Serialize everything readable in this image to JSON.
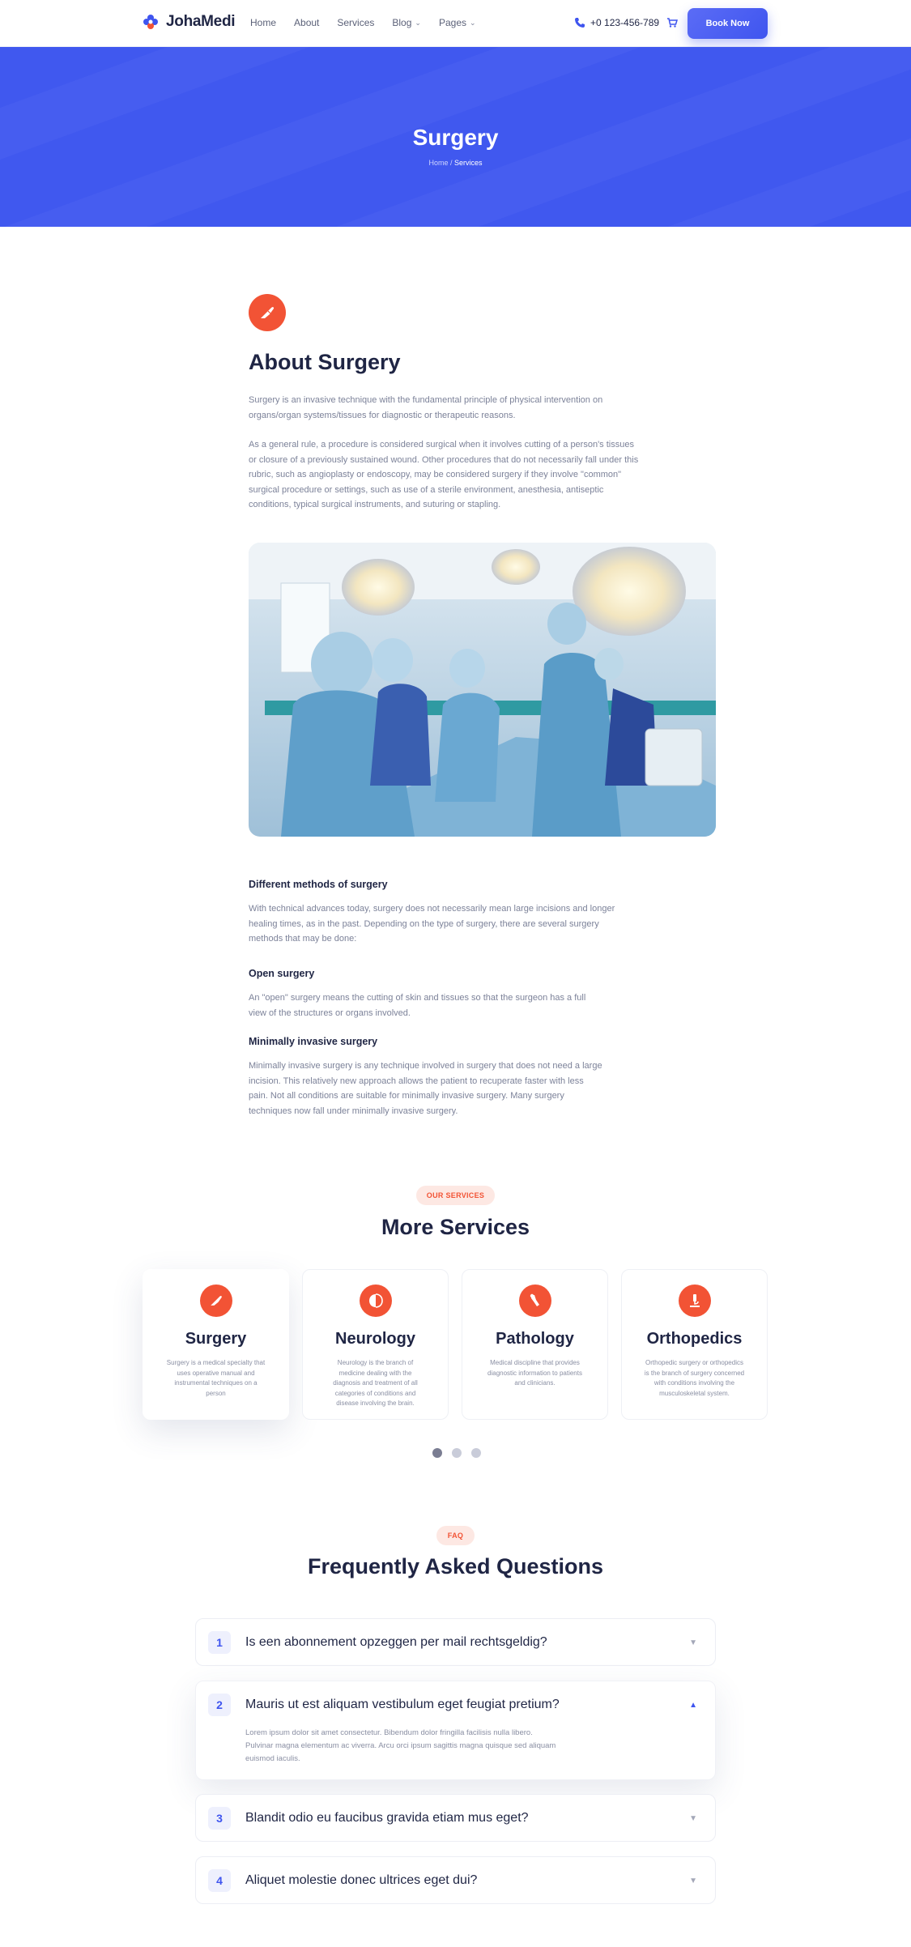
{
  "nav": {
    "logo": "JohaMedi",
    "menu": [
      {
        "label": "Home"
      },
      {
        "label": "About"
      },
      {
        "label": "Services"
      },
      {
        "label": "Blog"
      },
      {
        "label": "Pages"
      }
    ],
    "phone": "+0 123-456-789",
    "book_label": "Book Now"
  },
  "hero": {
    "title": "Surgery",
    "breadcrumb_home": "Home",
    "breadcrumb_sep": "/",
    "breadcrumb_current": "Services"
  },
  "about": {
    "title": "About Surgery",
    "p1": "Surgery is an invasive technique with the fundamental principle of physical intervention on organs/organ systems/tissues for diagnostic or therapeutic reasons.",
    "p2": "As a general rule, a procedure is considered surgical when it involves cutting of a person's tissues or closure of a previously sustained wound. Other procedures that do not necessarily fall under this rubric, such as angioplasty or endoscopy, may be considered surgery if they involve \"common\" surgical procedure or settings, such as use of a sterile environment, anesthesia, antiseptic conditions, typical surgical instruments, and suturing or stapling.",
    "methods_title": "Different methods of surgery",
    "methods_text": "With technical advances today, surgery does not necessarily mean large incisions and longer healing times, as in the past. Depending on the type of surgery, there are several surgery methods that may be done:",
    "open_title": "Open surgery",
    "open_text": "An \"open\" surgery means the cutting of skin and tissues so that the surgeon has a full view of the structures or organs involved.",
    "min_title": "Minimally invasive surgery",
    "min_text": "Minimally invasive surgery is any technique involved in surgery that does not need a large incision. This relatively new approach allows the patient to recuperate faster with less pain. Not all conditions are suitable for minimally invasive surgery. Many surgery techniques now fall under minimally invasive surgery."
  },
  "services": {
    "tag": "OUR SERVICES",
    "title": "More Services",
    "cards": [
      {
        "title": "Surgery",
        "desc": "Surgery is a medical specialty that uses operative manual and instrumental techniques on a person",
        "icon": "scalpel-icon"
      },
      {
        "title": "Neurology",
        "desc": "Neurology is the branch of medicine dealing with the diagnosis and treatment of all categories of conditions and disease involving the brain.",
        "icon": "brain-icon"
      },
      {
        "title": "Pathology",
        "desc": "Medical discipline that provides diagnostic information to patients and clinicians.",
        "icon": "bone-icon"
      },
      {
        "title": "Orthopedics",
        "desc": "Orthopedic surgery or orthopedics is the branch of surgery concerned with conditions involving the musculoskeletal system.",
        "icon": "microscope-icon"
      }
    ]
  },
  "faq": {
    "tag": "FAQ",
    "title": "Frequently Asked Questions",
    "items": [
      {
        "num": "1",
        "q": "Is een abonnement opzeggen per mail rechtsgeldig?"
      },
      {
        "num": "2",
        "q": "Mauris ut est aliquam vestibulum eget feugiat pretium?",
        "a": "Lorem ipsum dolor sit amet consectetur. Bibendum dolor fringilla facilisis nulla libero. Pulvinar magna elementum ac viverra. Arcu orci ipsum sagittis magna quisque sed aliquam euismod iaculis."
      },
      {
        "num": "3",
        "q": "Blandit odio eu faucibus gravida etiam mus eget?"
      },
      {
        "num": "4",
        "q": "Aliquet molestie donec ultrices eget dui?"
      }
    ]
  },
  "colors": {
    "brand": "#3f55ef",
    "accent": "#f25335",
    "text": "#1f2544"
  }
}
